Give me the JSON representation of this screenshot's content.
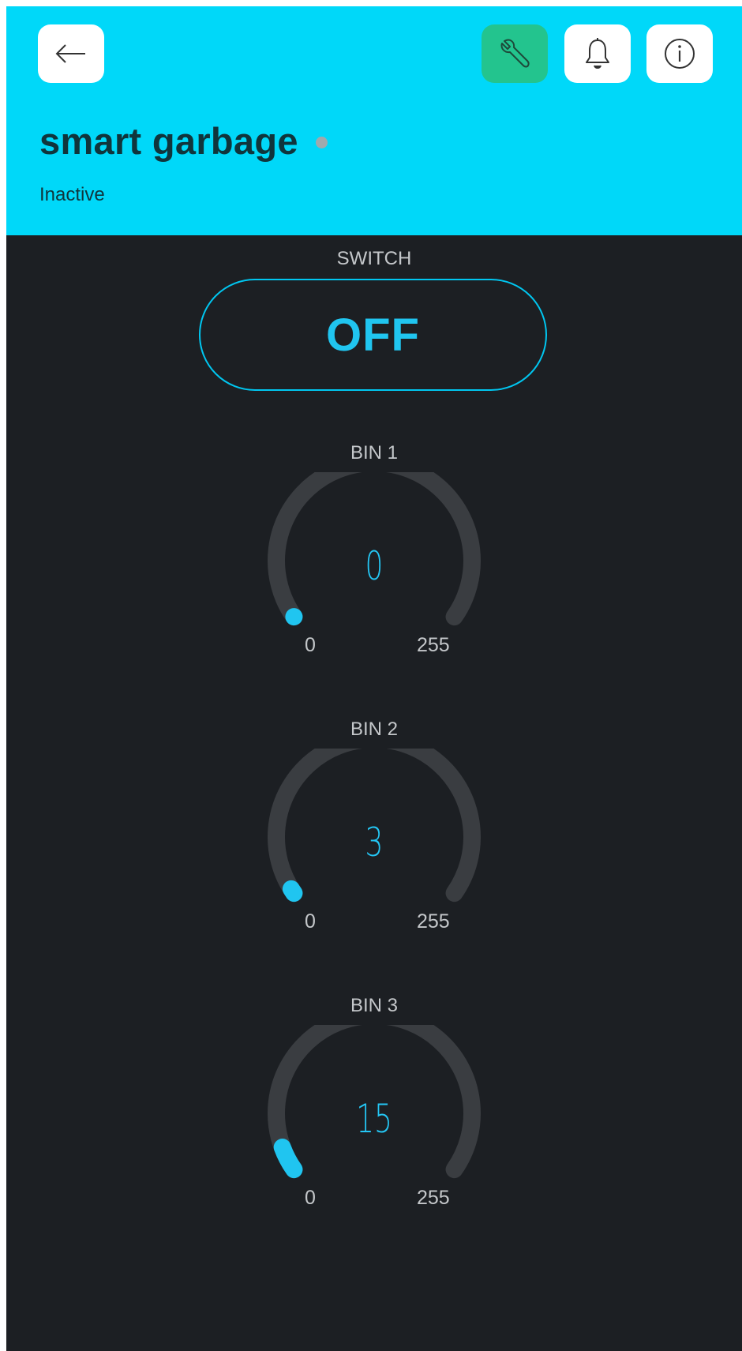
{
  "header": {
    "title": "smart garbage",
    "status": "Inactive",
    "buttons": {
      "back_icon": "arrow-left-icon",
      "wrench_icon": "wrench-icon",
      "bell_icon": "bell-icon",
      "info_icon": "info-icon"
    }
  },
  "switch": {
    "label": "SWITCH",
    "state_text": "OFF"
  },
  "gauges": [
    {
      "label": "BIN 1",
      "value": 0,
      "value_text": "0",
      "min": "0",
      "max": "255"
    },
    {
      "label": "BIN 2",
      "value": 3,
      "value_text": "3",
      "min": "0",
      "max": "255"
    },
    {
      "label": "BIN 3",
      "value": 15,
      "value_text": "15",
      "min": "0",
      "max": "255"
    }
  ],
  "colors": {
    "header_bg": "#00d8f9",
    "app_bg": "#1c1f23",
    "accent": "#20c5f0",
    "wrench_button": "#23c48e",
    "gauge_track": "#3a3d41",
    "status_dot": "#9fa9ad"
  }
}
